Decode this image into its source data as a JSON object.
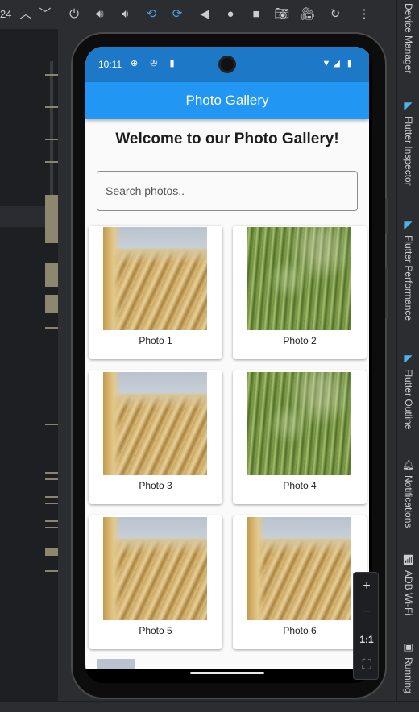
{
  "toolbar": {
    "left_text": "24",
    "icons": [
      "chevron-up-icon",
      "chevron-down-icon",
      "power-icon",
      "volume-up-icon",
      "volume-down-icon",
      "rotate-left-icon",
      "rotate-right-icon",
      "back-icon",
      "home-icon",
      "overview-icon",
      "camera-icon",
      "video-icon",
      "replay-icon",
      "more-icon"
    ]
  },
  "right_tabs": [
    {
      "label": "Device Manager",
      "icon": ""
    },
    {
      "label": "Flutter Inspector",
      "icon": "flutter-icon"
    },
    {
      "label": "Flutter Performance",
      "icon": "flutter-icon"
    },
    {
      "label": "Flutter Outline",
      "icon": "flutter-icon"
    },
    {
      "label": "Notifications",
      "icon": "bell-icon"
    },
    {
      "label": "ADB Wi-Fi",
      "icon": "wifi-icon"
    },
    {
      "label": "Running",
      "icon": "running-device-icon"
    }
  ],
  "status_bar": {
    "time": "10:11",
    "left_icons": "⊕ ✇ ▮",
    "right_icons": "▼◢ ▮"
  },
  "app": {
    "title": "Photo Gallery",
    "welcome": "Welcome to our Photo Gallery!",
    "search_placeholder": "Search photos..",
    "search_value": ""
  },
  "photos": [
    {
      "caption": "Photo 1",
      "kind": "wheat"
    },
    {
      "caption": "Photo 2",
      "kind": "grass"
    },
    {
      "caption": "Photo 3",
      "kind": "wheat"
    },
    {
      "caption": "Photo 4",
      "kind": "grass"
    },
    {
      "caption": "Photo 5",
      "kind": "wheat"
    },
    {
      "caption": "Photo 6",
      "kind": "wheat"
    }
  ],
  "zoom_controls": {
    "plus": "+",
    "minus": "−",
    "one_to_one": "1:1",
    "fit": "⛶"
  },
  "colors": {
    "appbar": "#2196f3",
    "statusbar": "#1e78c8",
    "ide_bg": "#2b2d30"
  }
}
